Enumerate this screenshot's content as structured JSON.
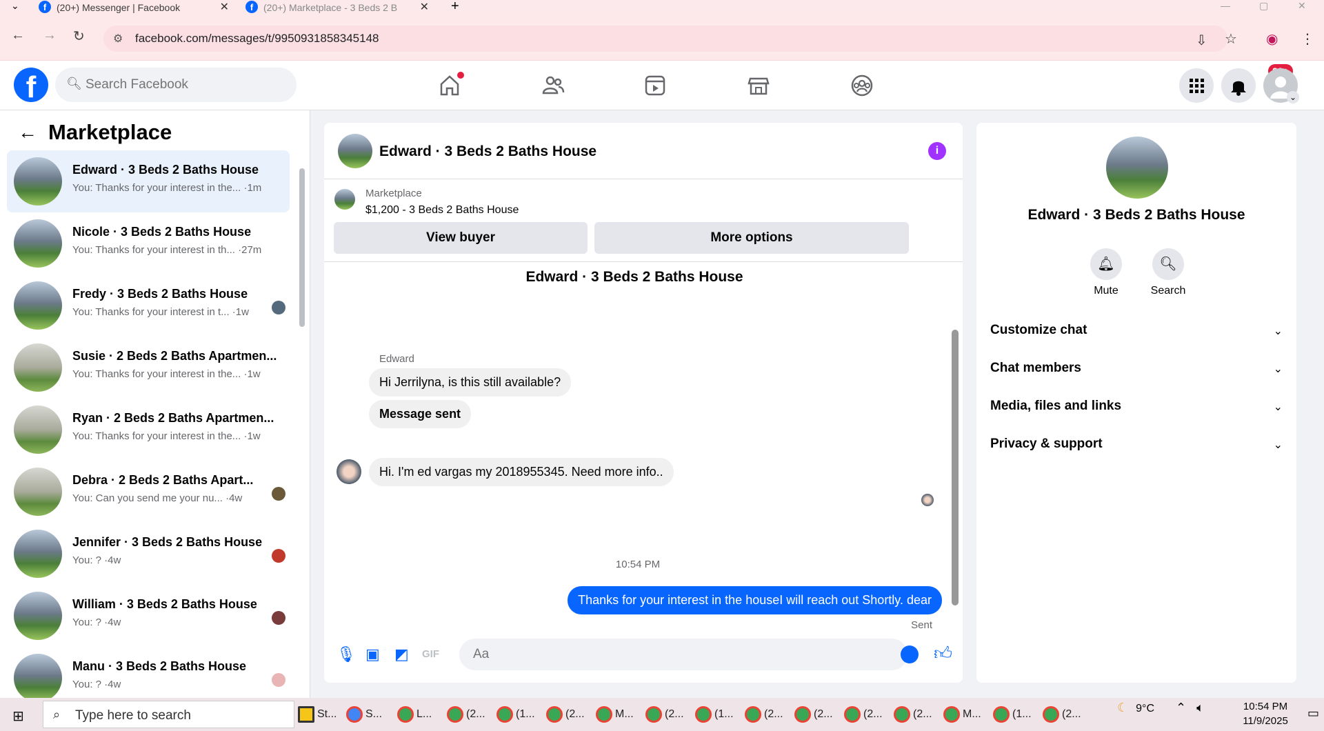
{
  "browser": {
    "tabs": [
      {
        "title": "(20+) Messenger | Facebook",
        "active": true
      },
      {
        "title": "(20+) Marketplace - 3 Beds 2 B",
        "active": false
      }
    ],
    "new_tab_label": "+",
    "url": "facebook.com/messages/t/9950931858345148"
  },
  "fb_header": {
    "logo": "f",
    "search_placeholder": "Search Facebook",
    "notification_badge": "20+",
    "nav_icons": [
      "home-icon",
      "friends-icon",
      "watch-icon",
      "marketplace-icon",
      "groups-icon"
    ]
  },
  "sidebar": {
    "back_icon": "←",
    "title": "Marketplace",
    "conversations": [
      {
        "name": "Edward · 3 Beds 2 Baths House",
        "snippet": "You: Thanks for your interest in the... ·1m",
        "active": true
      },
      {
        "name": "Nicole · 3 Beds 2 Baths House",
        "snippet": "You: Thanks for your interest in th... ·27m",
        "active": false
      },
      {
        "name": "Fredy · 3 Beds 2 Baths House",
        "snippet": "You: Thanks for your interest in t... ·1w",
        "active": false
      },
      {
        "name": "Susie · 2 Beds 2 Baths Apartmen...",
        "snippet": "You: Thanks for your interest in the... ·1w",
        "active": false
      },
      {
        "name": "Ryan · 2 Beds 2 Baths Apartmen...",
        "snippet": "You: Thanks for your interest in the... ·1w",
        "active": false
      },
      {
        "name": "Debra · 2 Beds 2 Baths Apart...",
        "snippet": "You: Can you send me your nu... ·4w",
        "active": false
      },
      {
        "name": "Jennifer · 3 Beds 2 Baths House",
        "snippet": "You: ? ·4w",
        "active": false
      },
      {
        "name": "William · 3 Beds 2 Baths House",
        "snippet": "You: ? ·4w",
        "active": false
      },
      {
        "name": "Manu · 3 Beds 2 Baths House",
        "snippet": "You: ? ·4w",
        "active": false
      }
    ]
  },
  "chat": {
    "title": "Edward · 3 Beds 2 Baths House",
    "info_icon": "i",
    "listing": {
      "source": "Marketplace",
      "price_title": "$1,200 - 3 Beds 2 Baths House",
      "view_buyer_label": "View buyer",
      "more_options_label": "More options"
    },
    "conversation_title": "Edward · 3 Beds 2 Baths House",
    "sender_name": "Edward",
    "messages": [
      {
        "text": "Hi Jerrilyna, is this still available?",
        "direction": "in"
      },
      {
        "text": "Message sent",
        "direction": "in"
      },
      {
        "text": "Hi. I'm ed vargas  my 2018955345. Need more info..",
        "direction": "in"
      },
      {
        "text": "Thanks for your interest in the houseI will reach out Shortly. dear",
        "direction": "out"
      }
    ],
    "timestamp": "10:54 PM",
    "sent_status": "Sent",
    "composer_placeholder": "Aa"
  },
  "details": {
    "name": "Edward · 3 Beds 2 Baths House",
    "actions": [
      {
        "label": "Mute",
        "icon": "bell-icon"
      },
      {
        "label": "Search",
        "icon": "search-icon"
      }
    ],
    "sections": [
      "Customize chat",
      "Chat members",
      "Media, files and links",
      "Privacy & support"
    ]
  },
  "taskbar": {
    "search_placeholder": "Type here to search",
    "apps": [
      "St...",
      "S...",
      "L...",
      "(2...",
      "(1...",
      "(2...",
      "M...",
      "(2...",
      "(1...",
      "(2...",
      "(2...",
      "(2...",
      "(2...",
      "M...",
      "(1...",
      "(2..."
    ],
    "temperature": "9°C",
    "time": "10:54 PM",
    "date": "11/9/2025"
  },
  "colors": {
    "brand": "#0866ff",
    "badge": "#e41e3f",
    "info": "#a033ff"
  }
}
